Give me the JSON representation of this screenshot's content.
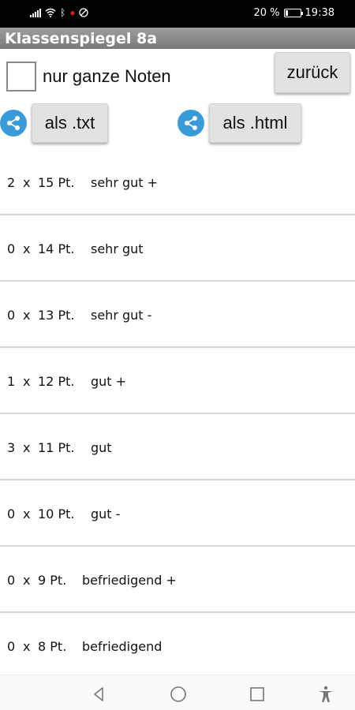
{
  "status_bar": {
    "battery_text": "20 %",
    "time": "19:38",
    "battery_level": 0.2,
    "icons": [
      "signal-icon",
      "wifi-icon",
      "bluetooth-icon",
      "notification-dot-icon",
      "do-not-disturb-icon"
    ]
  },
  "app": {
    "title": "Klassenspiegel 8a"
  },
  "controls": {
    "checkbox_label": "nur ganze Noten",
    "checkbox_checked": false,
    "back_button": "zurück",
    "export_txt": "als .txt",
    "export_html": "als .html"
  },
  "grades": [
    {
      "count": "2",
      "x": "x",
      "points": "15 Pt.",
      "grade": "sehr gut +"
    },
    {
      "count": "0",
      "x": "x",
      "points": "14 Pt.",
      "grade": "sehr gut"
    },
    {
      "count": "0",
      "x": "x",
      "points": "13 Pt.",
      "grade": "sehr gut -"
    },
    {
      "count": "1",
      "x": "x",
      "points": "12 Pt.",
      "grade": "gut +"
    },
    {
      "count": "3",
      "x": "x",
      "points": "11 Pt.",
      "grade": "gut"
    },
    {
      "count": "0",
      "x": "x",
      "points": "10 Pt.",
      "grade": "gut -"
    },
    {
      "count": "0",
      "x": "x",
      "points": "9 Pt.",
      "grade": "befriedigend +"
    },
    {
      "count": "0",
      "x": "x",
      "points": "8 Pt.",
      "grade": "befriedigend"
    }
  ],
  "nav_bar": {
    "icons": [
      "back-icon",
      "home-icon",
      "recents-icon",
      "accessibility-icon"
    ]
  },
  "colors": {
    "title_bar": "#8c8c8c",
    "share_icon": "#3b9bd9",
    "button_bg": "#e2e2e2",
    "divider": "#d6d6d6"
  }
}
